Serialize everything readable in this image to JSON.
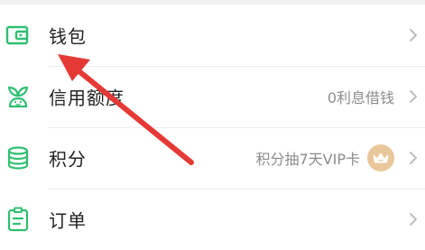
{
  "menu": {
    "items": [
      {
        "label": "钱包",
        "icon": "wallet-icon",
        "right_text": ""
      },
      {
        "label": "信用额度",
        "icon": "sprout-icon",
        "right_text": "0利息借钱"
      },
      {
        "label": "积分",
        "icon": "coins-stack-icon",
        "right_text": "积分抽7天VIP卡",
        "badge": "crown-icon"
      },
      {
        "label": "订单",
        "icon": "clipboard-icon",
        "right_text": ""
      }
    ]
  },
  "colors": {
    "icon_green": "#2fbf71",
    "arrow_red": "#e53935",
    "badge_gold": "#e9c79a"
  }
}
